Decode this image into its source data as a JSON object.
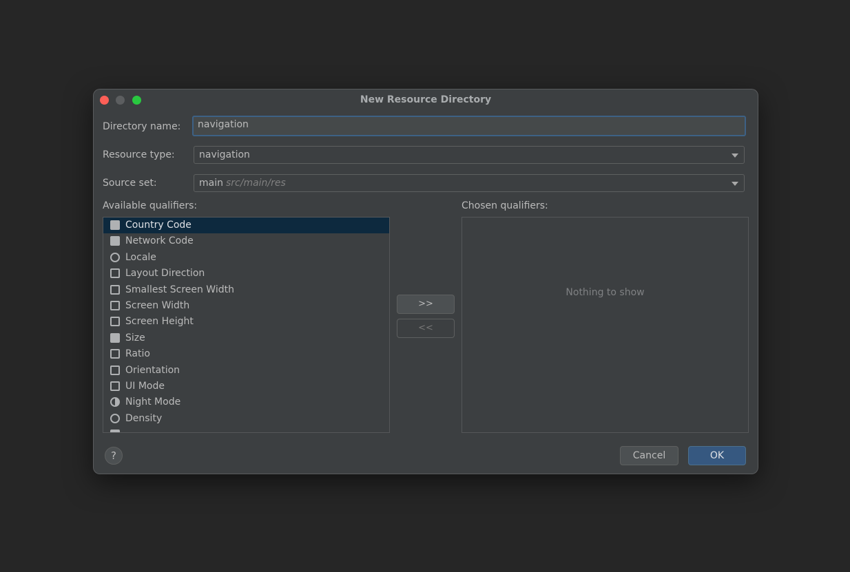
{
  "window": {
    "title": "New Resource Directory"
  },
  "form": {
    "directory_name_label": "Directory name:",
    "directory_name_value": "navigation",
    "resource_type_label": "Resource type:",
    "resource_type_value": "navigation",
    "source_set_label": "Source set:",
    "source_set_value": "main",
    "source_set_hint": "src/main/res"
  },
  "available": {
    "label": "Available qualifiers:",
    "items": [
      {
        "label": "Country Code",
        "icon": "country-code-icon"
      },
      {
        "label": "Network Code",
        "icon": "network-code-icon"
      },
      {
        "label": "Locale",
        "icon": "globe-icon"
      },
      {
        "label": "Layout Direction",
        "icon": "layout-direction-icon"
      },
      {
        "label": "Smallest Screen Width",
        "icon": "smallest-screen-width-icon"
      },
      {
        "label": "Screen Width",
        "icon": "screen-width-icon"
      },
      {
        "label": "Screen Height",
        "icon": "screen-height-icon"
      },
      {
        "label": "Size",
        "icon": "size-icon"
      },
      {
        "label": "Ratio",
        "icon": "ratio-icon"
      },
      {
        "label": "Orientation",
        "icon": "orientation-icon"
      },
      {
        "label": "UI Mode",
        "icon": "ui-mode-icon"
      },
      {
        "label": "Night Mode",
        "icon": "night-mode-icon"
      },
      {
        "label": "Density",
        "icon": "density-icon"
      }
    ],
    "selected_index": 0
  },
  "chosen": {
    "label": "Chosen qualifiers:",
    "empty_text": "Nothing to show"
  },
  "buttons": {
    "add": ">>",
    "remove": "<<",
    "help": "?",
    "cancel": "Cancel",
    "ok": "OK"
  },
  "colors": {
    "accent": "#365880",
    "selection": "#0d293e",
    "focus_border": "#3d6185"
  }
}
